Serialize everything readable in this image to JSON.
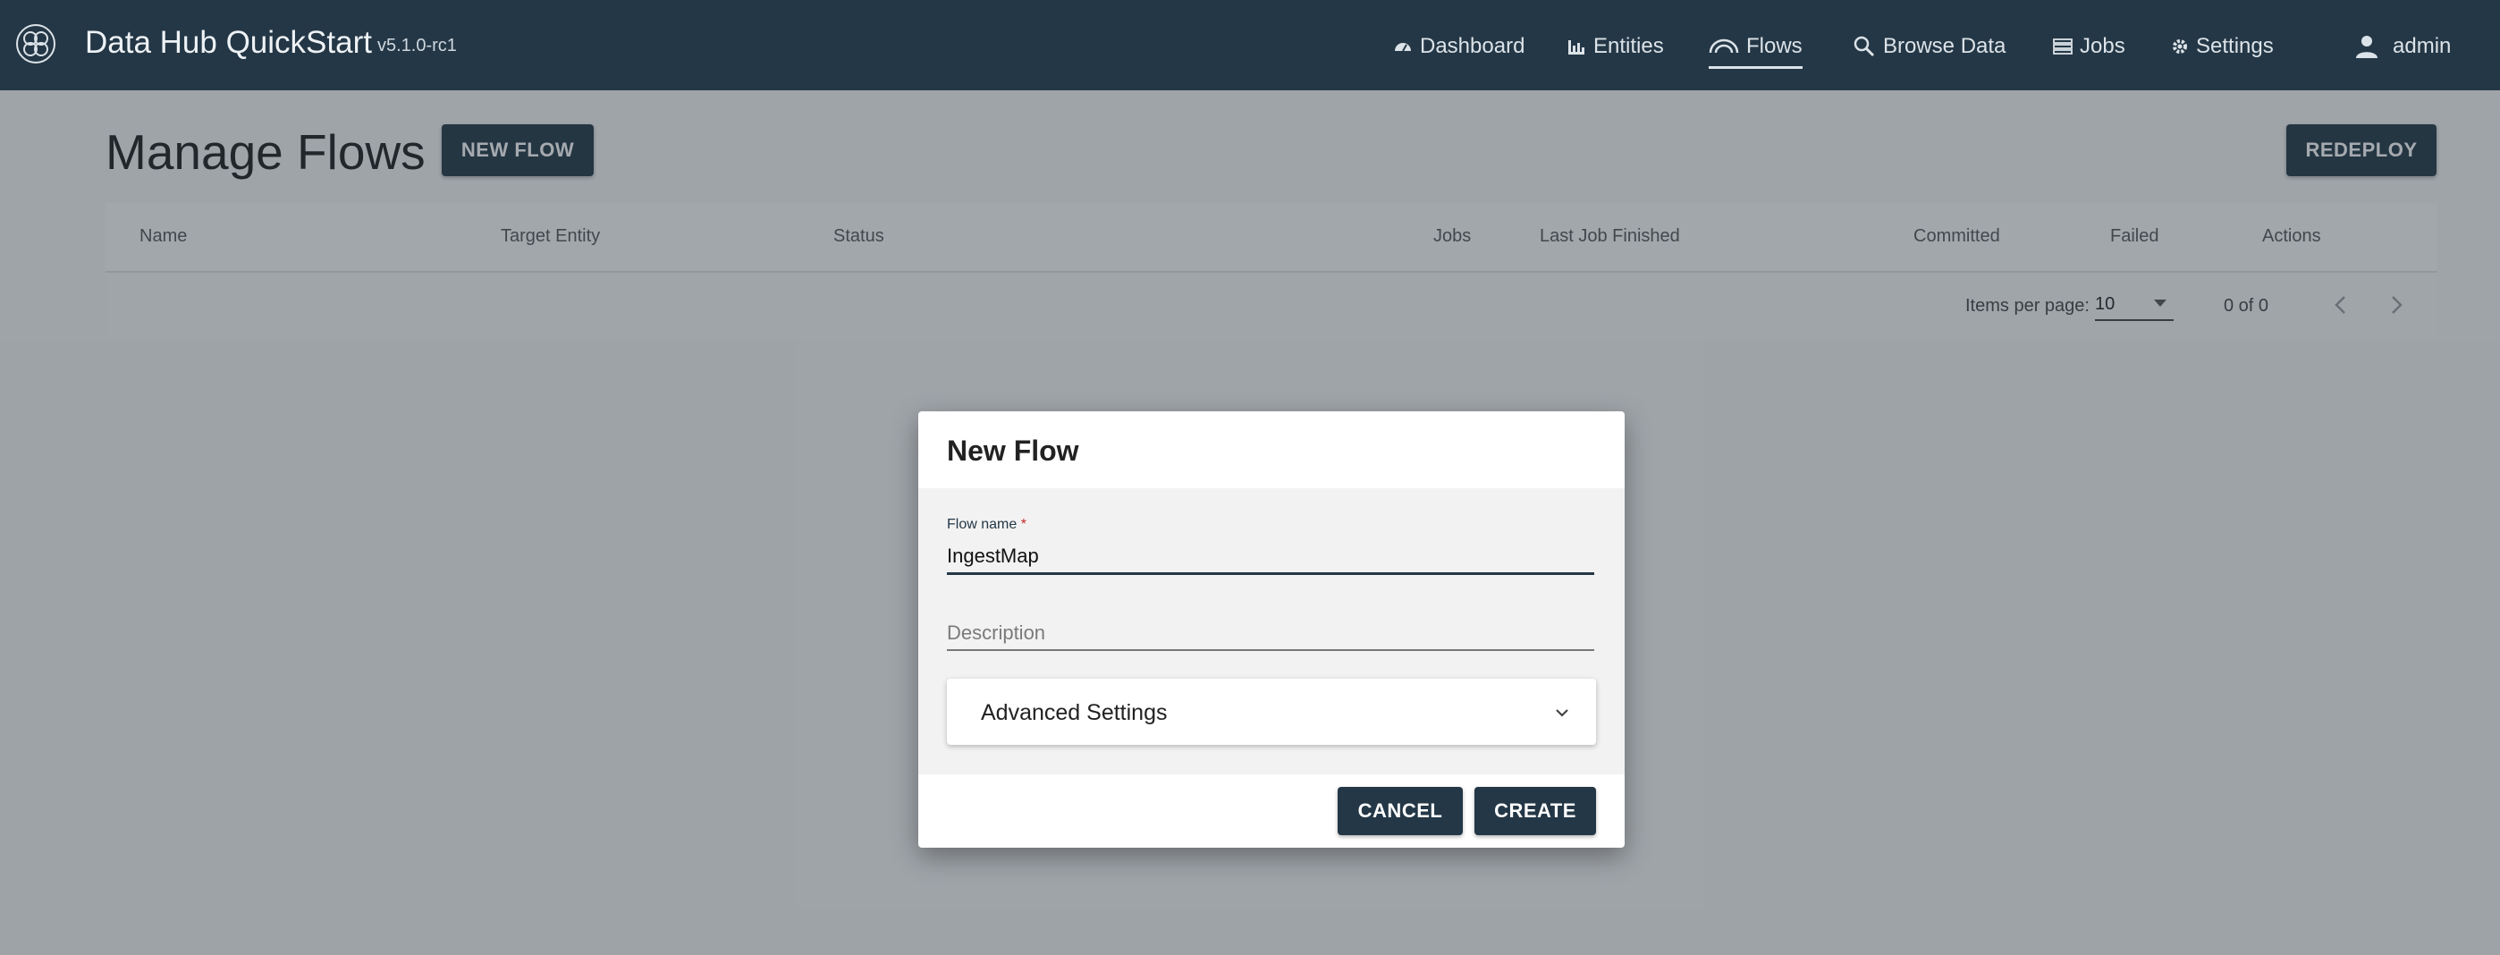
{
  "app": {
    "title": "Data Hub QuickStart",
    "version": "v5.1.0-rc1"
  },
  "nav": {
    "dashboard": "Dashboard",
    "entities": "Entities",
    "flows": "Flows",
    "browse": "Browse Data",
    "jobs": "Jobs",
    "settings": "Settings",
    "user": "admin",
    "active": "flows"
  },
  "page": {
    "title": "Manage Flows",
    "new_flow_button": "NEW FLOW",
    "redeploy_button": "REDEPLOY"
  },
  "table": {
    "columns": [
      "Name",
      "Target Entity",
      "Status",
      "Jobs",
      "Last Job Finished",
      "Committed",
      "Failed",
      "Actions"
    ],
    "rows": [],
    "items_per_page_label": "Items per page:",
    "items_per_page_value": "10",
    "range_label": "0 of 0"
  },
  "dialog": {
    "title": "New Flow",
    "flow_name_label": "Flow name",
    "required_marker": "*",
    "flow_name_value": "IngestMap",
    "description_placeholder": "Description",
    "advanced_settings_label": "Advanced Settings",
    "cancel_label": "CANCEL",
    "create_label": "CREATE"
  },
  "colors": {
    "topbar": "#243746",
    "primary_button": "#243746",
    "required": "#c62828"
  }
}
